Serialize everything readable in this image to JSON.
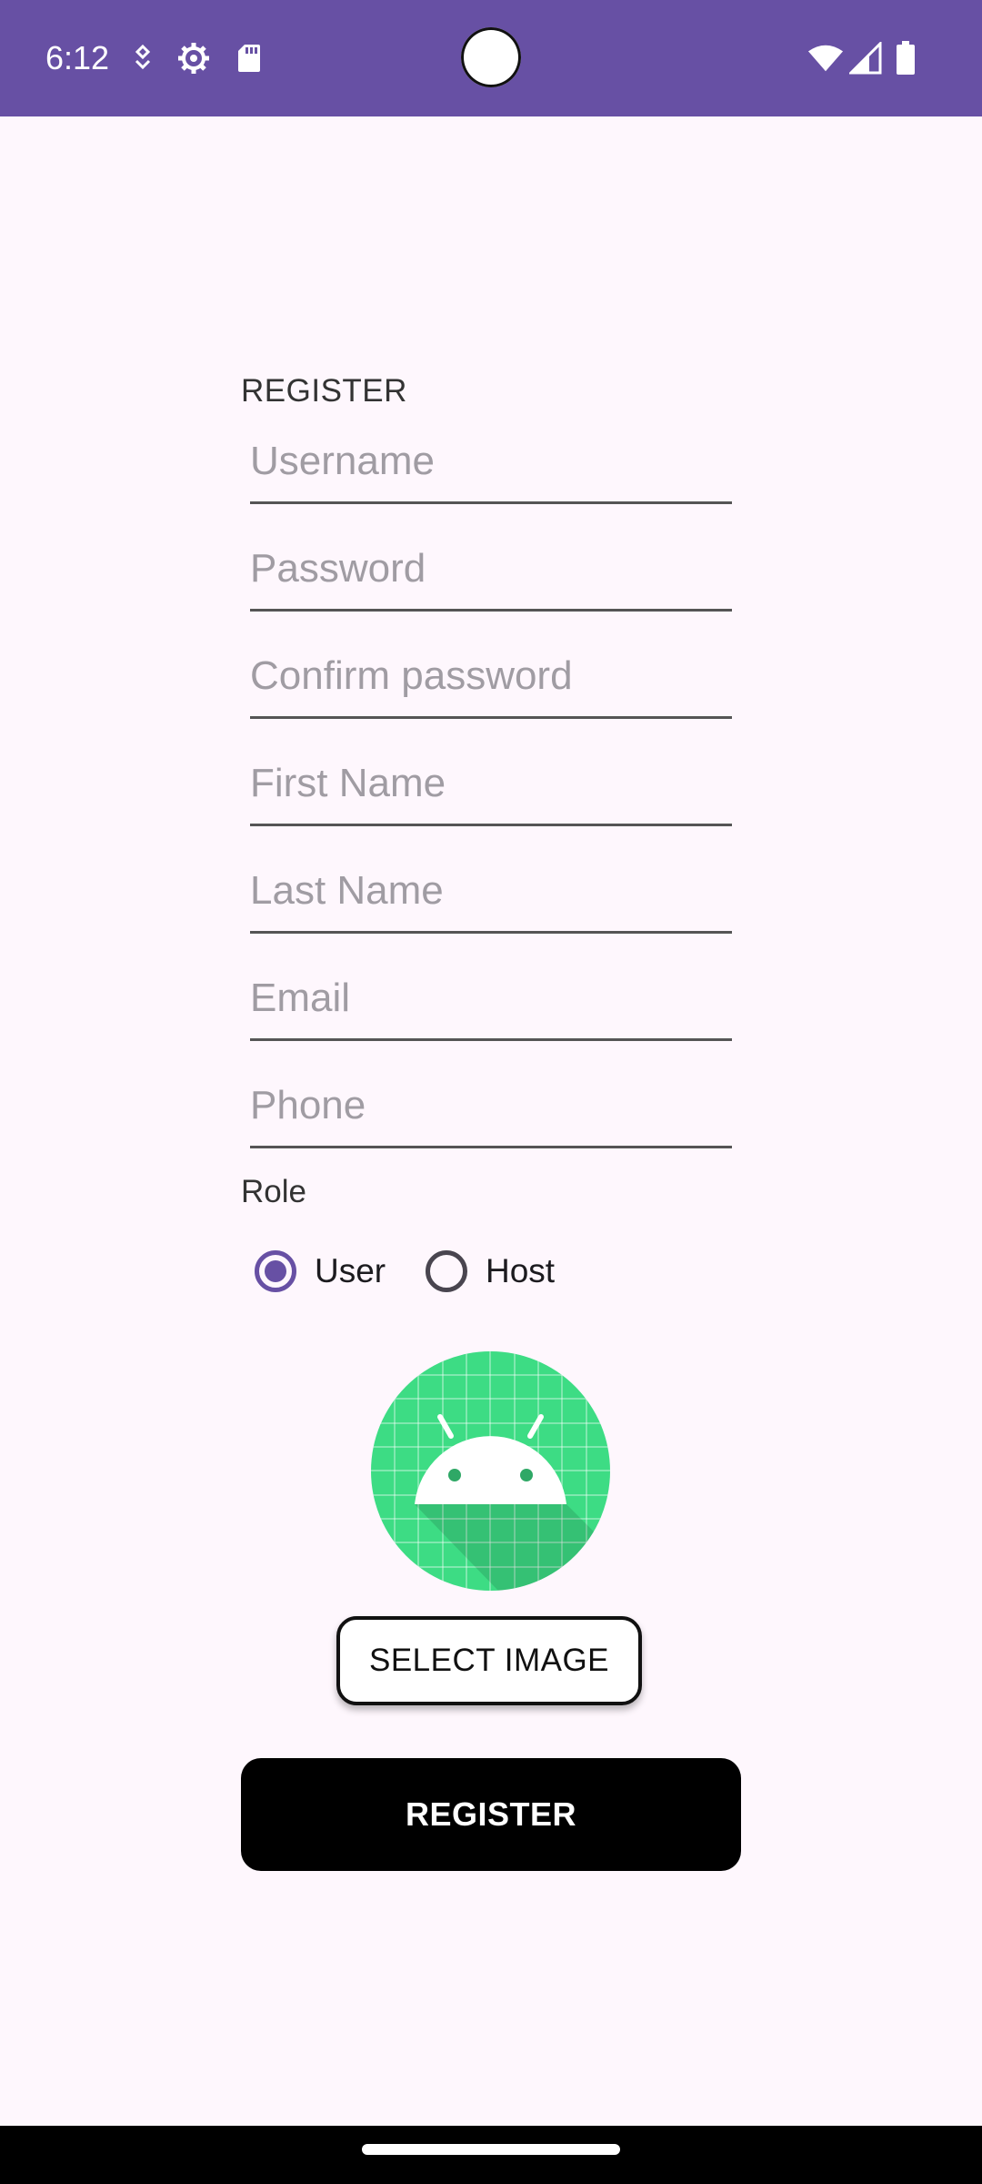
{
  "status_bar": {
    "time": "6:12",
    "color": "#6750a4",
    "left_icons": [
      "notification-icon",
      "settings-icon",
      "sd-card-icon"
    ],
    "right_icons": [
      "wifi-icon",
      "signal-icon",
      "battery-icon"
    ]
  },
  "form": {
    "title": "REGISTER",
    "fields": {
      "username": {
        "placeholder": "Username",
        "value": ""
      },
      "password": {
        "placeholder": "Password",
        "value": ""
      },
      "confirm_password": {
        "placeholder": "Confirm password",
        "value": ""
      },
      "first_name": {
        "placeholder": "First Name",
        "value": ""
      },
      "last_name": {
        "placeholder": "Last Name",
        "value": ""
      },
      "email": {
        "placeholder": "Email",
        "value": ""
      },
      "phone": {
        "placeholder": "Phone",
        "value": ""
      }
    },
    "role": {
      "label": "Role",
      "options": [
        "User",
        "Host"
      ],
      "selected": "User"
    },
    "avatar_icon": "android-logo-icon",
    "select_image_label": "SELECT IMAGE",
    "register_label": "REGISTER"
  },
  "colors": {
    "accent": "#6750a4",
    "background": "#fef7fd",
    "button_dark": "#000000",
    "avatar_green": "#3ddc84"
  }
}
